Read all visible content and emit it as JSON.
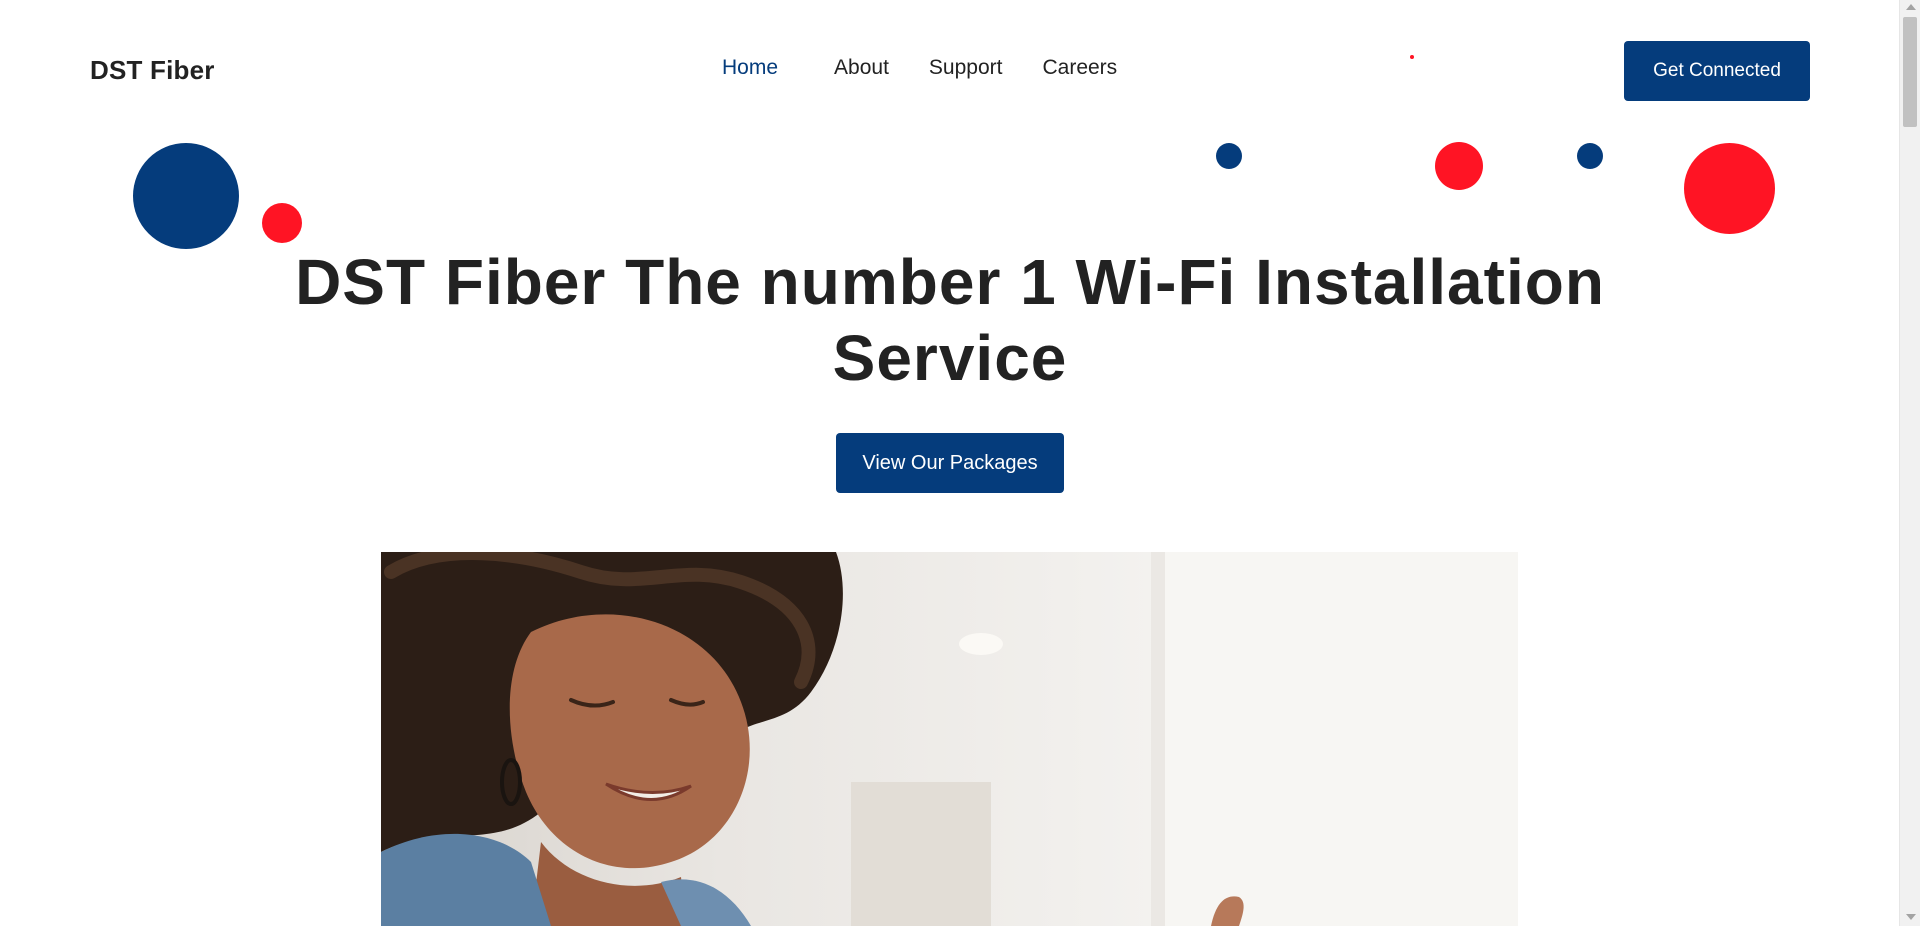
{
  "header": {
    "brand": "DST Fiber",
    "nav": [
      {
        "label": "Home",
        "active": true
      },
      {
        "label": "About",
        "active": false
      },
      {
        "label": "Support",
        "active": false
      },
      {
        "label": "Careers",
        "active": false
      }
    ],
    "cta_label": "Get Connected"
  },
  "hero": {
    "title_line1": "DST Fiber The number 1 Wi-Fi Installation",
    "title_line2": "Service",
    "cta_label": "View Our Packages"
  },
  "photo": {
    "subject": "woman-smiling-photo"
  },
  "colors": {
    "brand_blue": "#053c7c",
    "accent_red": "#ff1424",
    "text": "#222222"
  }
}
